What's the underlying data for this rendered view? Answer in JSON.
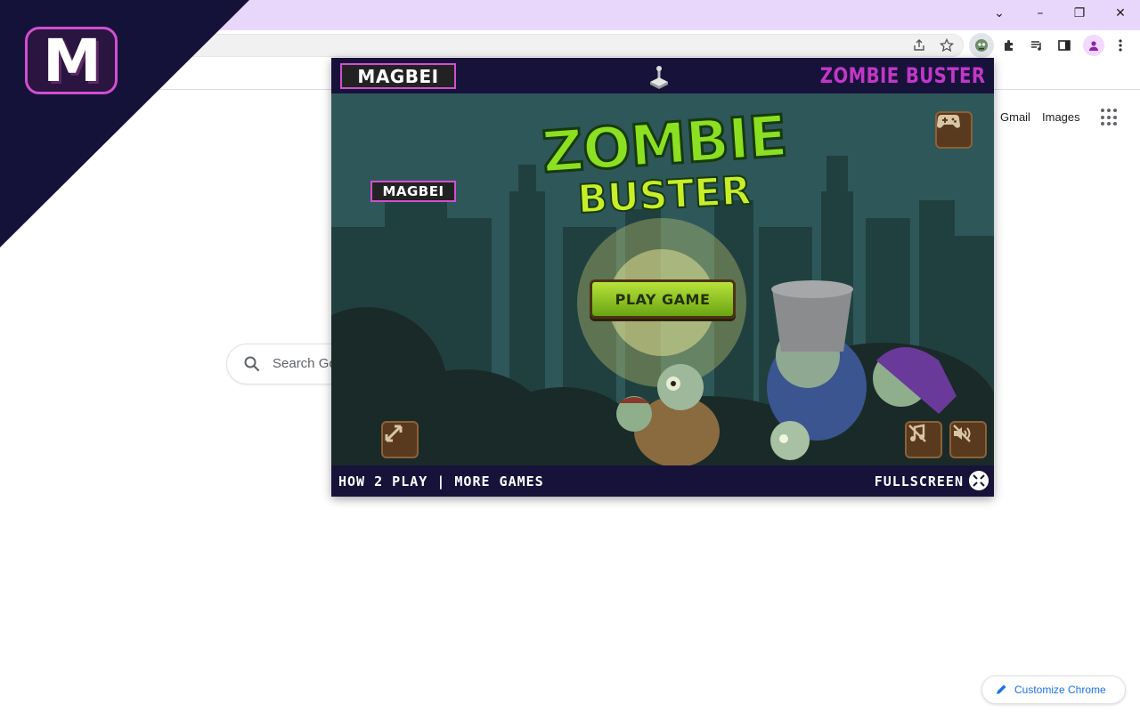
{
  "browser": {
    "window_controls": {
      "tab_search": "⌄",
      "minimize": "–",
      "restore": "❐",
      "close": "✕"
    },
    "toolbar_icons": [
      "share-icon",
      "bookmark-star-icon",
      "extension-zombie-icon",
      "puzzle-extensions-icon",
      "media-playlist-icon",
      "side-panel-icon",
      "profile-avatar-icon",
      "kebab-menu-icon"
    ]
  },
  "google": {
    "links": {
      "gmail": "Gmail",
      "images": "Images"
    },
    "search": {
      "placeholder": "Search Go"
    },
    "customize_label": "Customize Chrome"
  },
  "overlay_logo": {
    "letter": "M",
    "colors": {
      "triangle": "#15123a",
      "border": "#d14fd0"
    }
  },
  "popup": {
    "header": {
      "brand": "MAGBEI",
      "title": "ZOMBIE BUSTER"
    },
    "game": {
      "brand_badge": "MAGBEI",
      "logo_line1": "ZOMBIE",
      "logo_line2": "BUSTER",
      "play_button": "PLAY GAME",
      "buttons": [
        "gamepad-icon",
        "fullscreen-expand-icon",
        "music-off-icon",
        "sound-off-icon"
      ]
    },
    "footer": {
      "left": "HOW 2 PLAY | MORE GAMES",
      "right": "FULLSCREEN"
    }
  },
  "colors": {
    "titlebar": "#e9d6fb",
    "popup_bg": "#17123a",
    "game_bg": "#2e5759",
    "accent_purple": "#c237c7",
    "zombie_green": "#8be021",
    "google_blue": "#1a73e8"
  }
}
